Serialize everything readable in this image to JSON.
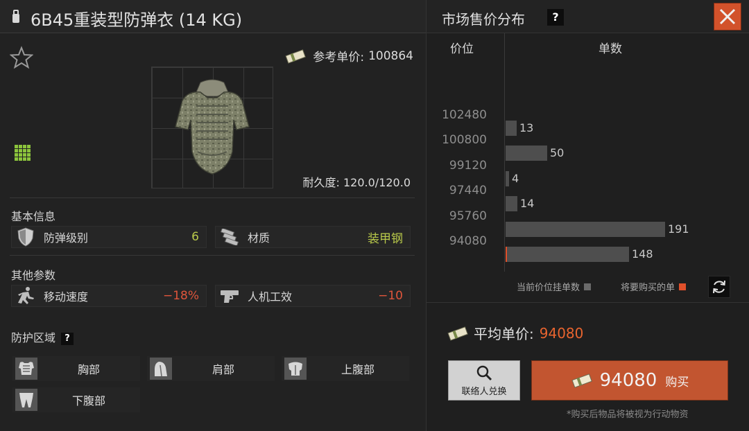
{
  "item": {
    "title": "6B45重装型防弹衣 (14 KG)",
    "ref_price_label": "参考单价:",
    "ref_price_value": "100864",
    "durability_label": "耐久度:",
    "durability_value": "120.0/120.0"
  },
  "basic_info": {
    "title": "基本信息",
    "stats": [
      {
        "name": "防弹级别",
        "value": "6",
        "icon": "shield-icon"
      },
      {
        "name": "材质",
        "value": "装甲钢",
        "icon": "armor-plates-icon"
      }
    ]
  },
  "other_params": {
    "title": "其他参数",
    "stats": [
      {
        "name": "移动速度",
        "value": "−18%",
        "icon": "running-man-icon"
      },
      {
        "name": "人机工效",
        "value": "−10",
        "icon": "pistol-icon"
      }
    ]
  },
  "protection": {
    "title": "防护区域",
    "help": "?",
    "zones": [
      {
        "name": "胸部",
        "icon": "chest-armor-icon"
      },
      {
        "name": "肩部",
        "icon": "shoulder-icon"
      },
      {
        "name": "上腹部",
        "icon": "upper-abdomen-icon"
      },
      {
        "name": "下腹部",
        "icon": "lower-abdomen-icon"
      }
    ]
  },
  "market": {
    "title": "市场售价分布",
    "help": "?",
    "price_header": "价位",
    "count_header": "单数",
    "legend_current": "当前价位挂单数",
    "legend_buy": "将要购买的单",
    "avg_label": "平均单价:",
    "avg_value": "94080",
    "contact_label": "联络人兑换",
    "buy_price": "94080",
    "buy_label": "购买",
    "note": "*购买后物品将被视为行动物资"
  },
  "colors": {
    "accent": "#c25530",
    "negative": "#e0553b",
    "positive": "#b9c94a",
    "bar": "#4e4e4e"
  },
  "chart_data": {
    "type": "bar",
    "orientation": "horizontal",
    "title": "",
    "ylabel": "价位",
    "xlabel": "单数",
    "tick_prices": [
      "102480",
      "100800",
      "99120",
      "97440",
      "95760",
      "94080"
    ],
    "values": [
      13,
      50,
      4,
      14,
      191,
      148
    ],
    "selected_index": 5
  }
}
